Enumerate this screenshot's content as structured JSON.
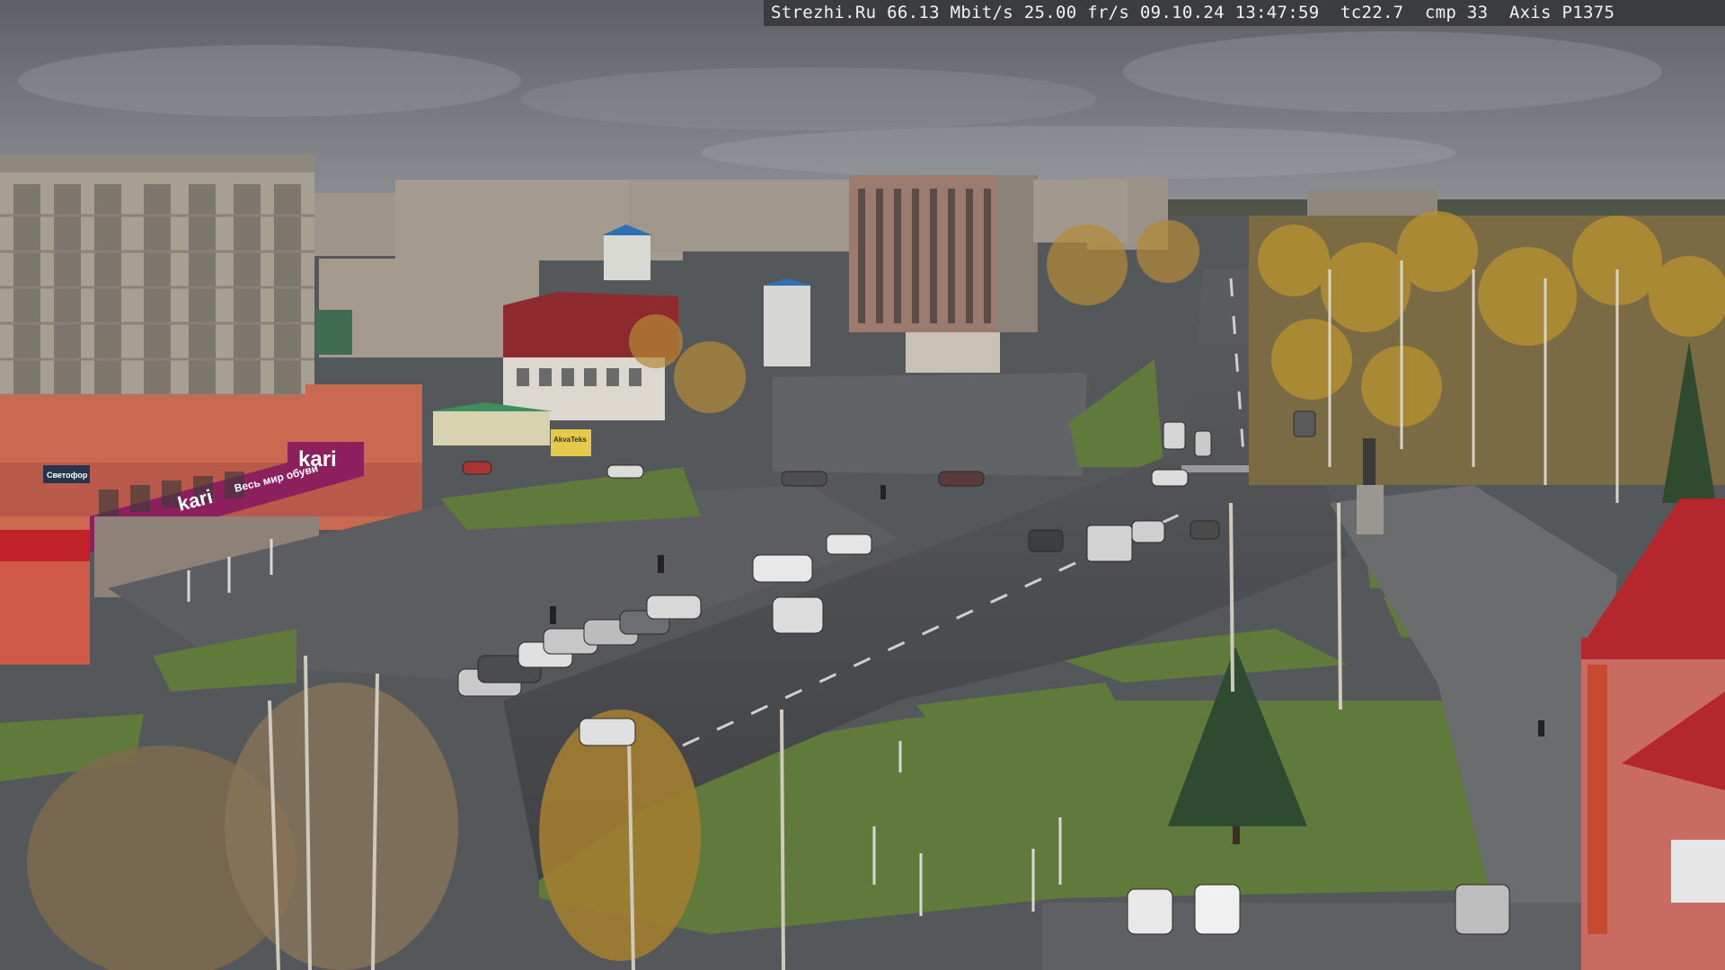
{
  "camera_overlay": {
    "site": "Strezhi.Ru",
    "bitrate": "66.13 Mbit/s",
    "framerate": "25.00 fr/s",
    "date": "09.10.24",
    "time": "13:47:59",
    "tc": "tc22.7",
    "cmp": "cmp 33",
    "device": "Axis P1375"
  },
  "store_signs": {
    "kari_roof": "kari",
    "kari_wall": "kari",
    "kari_banner": "Весь мир обуви",
    "shop_small": "Светофор",
    "yellow_board": "AkvaTeks"
  },
  "scene_colors": {
    "sky": "#6f7479",
    "asphalt": "#4d4f52",
    "grass": "#5f7a3a",
    "building_panel": "#a79c8f",
    "brick_red": "#c0392b",
    "kari_magenta": "#8c1f5e"
  }
}
